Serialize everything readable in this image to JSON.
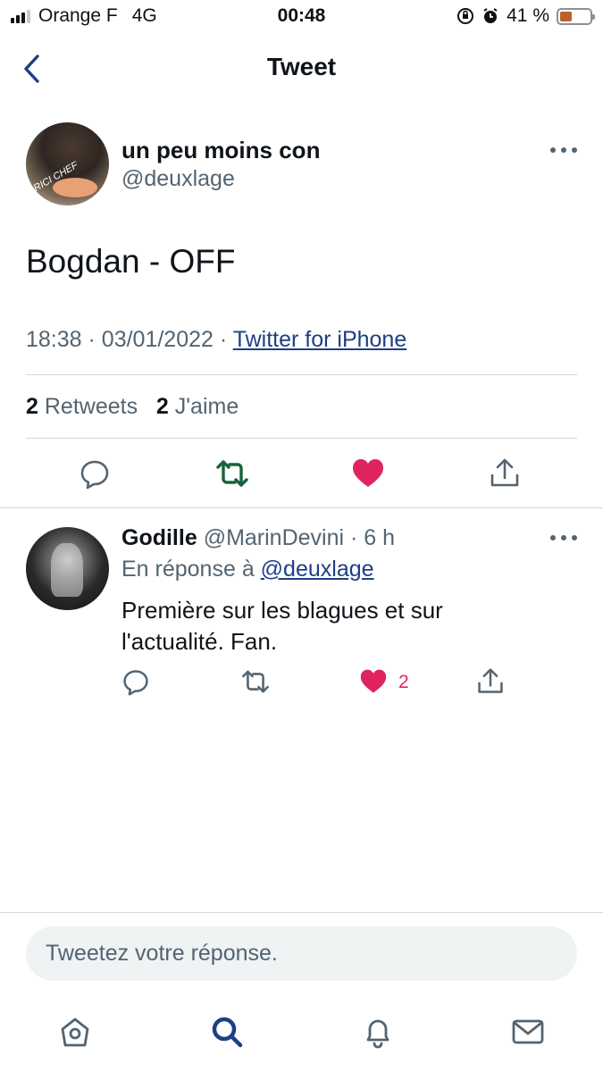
{
  "status_bar": {
    "carrier": "Orange F",
    "network": "4G",
    "time": "00:48",
    "battery_percent": "41 %",
    "battery_level": 0.41
  },
  "nav": {
    "title": "Tweet"
  },
  "tweet": {
    "author_name": "un peu moins con",
    "author_handle": "@deuxlage",
    "avatar_caption": "RICI CHEF",
    "text": "Bogdan - OFF",
    "time": "18:38",
    "date": "03/01/2022",
    "sep": "·",
    "source": "Twitter for iPhone",
    "retweets_count": "2",
    "retweets_label": "Retweets",
    "likes_count": "2",
    "likes_label": "J'aime"
  },
  "reply": {
    "author_name": "Godille",
    "author_handle": "@MarinDevini",
    "sep": "·",
    "age": "6 h",
    "reply_to_label": "En réponse à",
    "reply_to_handle": "@deuxlage",
    "text": "Première sur les blagues et sur l'actualité. Fan.",
    "like_count": "2"
  },
  "compose": {
    "placeholder": "Tweetez votre réponse."
  },
  "tab_bar": {
    "icons": [
      "home-icon",
      "search-icon",
      "notifications-icon",
      "messages-icon"
    ]
  },
  "colors": {
    "accent": "#1d3f86",
    "retweet_active": "#17633d",
    "like": "#e0245e",
    "secondary_text": "#536471",
    "divider": "#cfd9de"
  }
}
